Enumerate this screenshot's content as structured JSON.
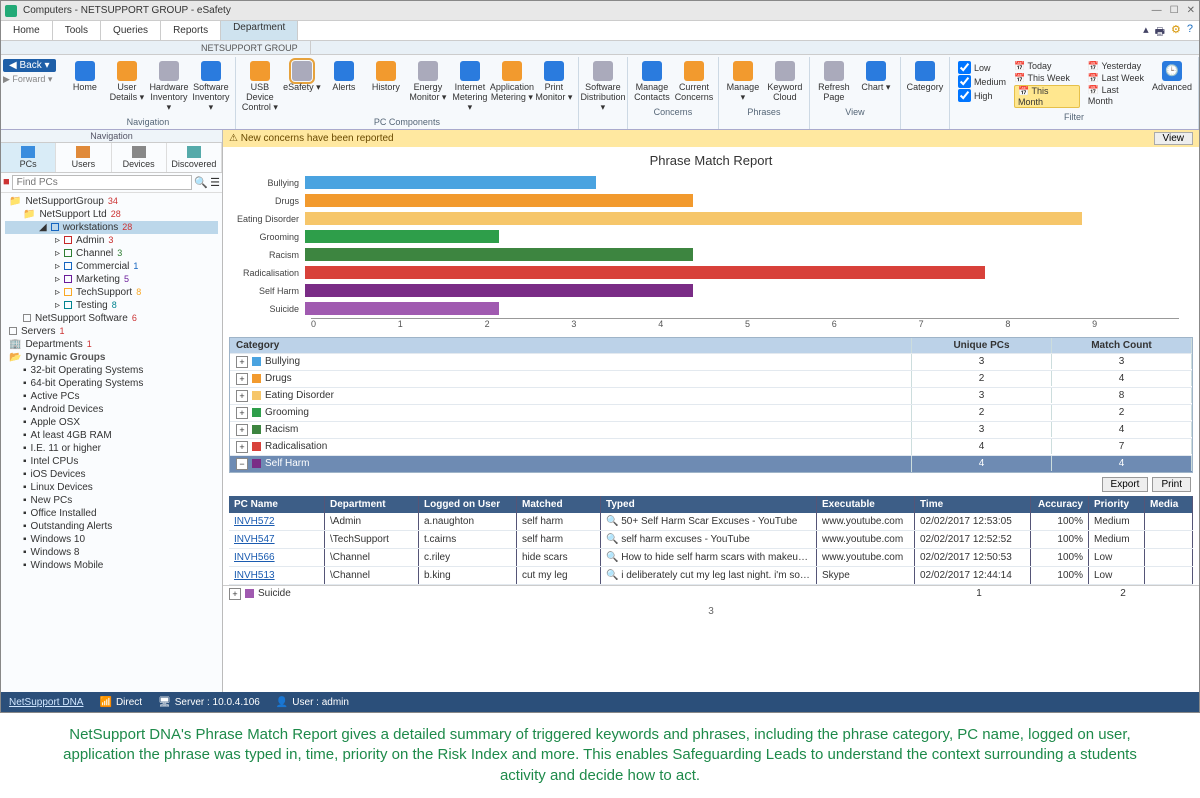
{
  "window": {
    "title": "Computers - NETSUPPORT GROUP - eSafety",
    "min": "—",
    "max": "☐",
    "close": "✕"
  },
  "tabs": {
    "main": "Department",
    "sub": "NETSUPPORT GROUP",
    "row_items": [
      "Home",
      "Tools",
      "Queries",
      "Reports"
    ]
  },
  "nav_back": "◀ Back ▾",
  "nav_fwd": "▶ Forward ▾",
  "ribbon": {
    "groups": [
      {
        "caption": "Navigation",
        "buttons": [
          "Home",
          "User Details ▾",
          "Hardware Inventory ▾",
          "Software Inventory ▾"
        ]
      },
      {
        "caption": "PC Components",
        "buttons": [
          "USB Device Control ▾",
          "eSafety ▾",
          "Alerts",
          "History",
          "Energy Monitor ▾",
          "Internet Metering ▾",
          "Application Metering ▾",
          "Print Monitor ▾"
        ]
      },
      {
        "caption": "",
        "buttons": [
          "Software Distribution ▾"
        ]
      },
      {
        "caption": "Concerns",
        "buttons": [
          "Manage Contacts",
          "Current Concerns"
        ]
      },
      {
        "caption": "Phrases",
        "buttons": [
          "Manage ▾",
          "Keyword Cloud"
        ]
      },
      {
        "caption": "View",
        "buttons": [
          "Refresh Page",
          "Chart ▾"
        ]
      },
      {
        "caption": "",
        "buttons": [
          "Category"
        ]
      }
    ],
    "filter": {
      "caption": "Filter",
      "severity": [
        "Low",
        "Medium",
        "High"
      ],
      "time_col1": [
        "Today",
        "This Week",
        "This Month"
      ],
      "time_col2": [
        "Yesterday",
        "Last Week",
        "Last Month"
      ],
      "advanced": "Advanced"
    }
  },
  "nav": {
    "caption": "Navigation",
    "tabs": [
      "PCs",
      "Users",
      "Devices",
      "Discovered"
    ],
    "search_placeholder": "Find PCs"
  },
  "tree": {
    "root": {
      "label": "NetSupportGroup",
      "count": "34"
    },
    "ltd": {
      "label": "NetSupport Ltd",
      "count": "28"
    },
    "ws": {
      "label": "workstations",
      "count": "28"
    },
    "ws_children": [
      {
        "label": "Admin",
        "count": "3",
        "color": "#c62828"
      },
      {
        "label": "Channel",
        "count": "3",
        "color": "#2e7d32"
      },
      {
        "label": "Commercial",
        "count": "1",
        "color": "#1565c0"
      },
      {
        "label": "Marketing",
        "count": "5",
        "color": "#6a1b9a"
      },
      {
        "label": "TechSupport",
        "count": "8",
        "color": "#f9a825"
      },
      {
        "label": "Testing",
        "count": "8",
        "color": "#00838f"
      }
    ],
    "nss": {
      "label": "NetSupport Software",
      "count": "6"
    },
    "servers": {
      "label": "Servers",
      "count": "1"
    },
    "depts": {
      "label": "Departments",
      "count": "1"
    },
    "dyn_header": "Dynamic Groups",
    "dynamic": [
      "32-bit Operating Systems",
      "64-bit Operating Systems",
      "Active PCs",
      "Android Devices",
      "Apple OSX",
      "At least 4GB RAM",
      "I.E. 11 or higher",
      "Intel CPUs",
      "iOS Devices",
      "Linux Devices",
      "New PCs",
      "Office Installed",
      "Outstanding Alerts",
      "Windows 10",
      "Windows 8",
      "Windows Mobile"
    ]
  },
  "alert": {
    "text": "New concerns have been reported",
    "view": "View"
  },
  "chart_data": {
    "type": "bar",
    "title": "Phrase Match Report",
    "categories": [
      "Bullying",
      "Drugs",
      "Eating Disorder",
      "Grooming",
      "Racism",
      "Radicalisation",
      "Self Harm",
      "Suicide"
    ],
    "values": [
      3,
      4,
      8,
      2,
      4,
      7,
      4,
      2
    ],
    "colors": [
      "#4aa3e0",
      "#f29a2e",
      "#f6c66a",
      "#2e9e4a",
      "#3d8540",
      "#d8413a",
      "#7a2c86",
      "#a05ab0"
    ],
    "xlabel": "",
    "ylabel": "",
    "xlim": [
      0,
      9
    ],
    "ticks": [
      "0",
      "1",
      "2",
      "3",
      "4",
      "5",
      "6",
      "7",
      "8",
      "9"
    ]
  },
  "cat_table": {
    "headers": [
      "Category",
      "Unique PCs",
      "Match Count"
    ],
    "rows": [
      {
        "name": "Bullying",
        "pcs": 3,
        "match": 3,
        "color": "#4aa3e0"
      },
      {
        "name": "Drugs",
        "pcs": 2,
        "match": 4,
        "color": "#f29a2e"
      },
      {
        "name": "Eating Disorder",
        "pcs": 3,
        "match": 8,
        "color": "#f6c66a"
      },
      {
        "name": "Grooming",
        "pcs": 2,
        "match": 2,
        "color": "#2e9e4a"
      },
      {
        "name": "Racism",
        "pcs": 3,
        "match": 4,
        "color": "#3d8540"
      },
      {
        "name": "Radicalisation",
        "pcs": 4,
        "match": 7,
        "color": "#d8413a"
      },
      {
        "name": "Self Harm",
        "pcs": 4,
        "match": 4,
        "color": "#7a2c86",
        "selected": true
      },
      {
        "name": "Suicide",
        "pcs": 1,
        "match": 2,
        "color": "#a05ab0",
        "footer": true
      }
    ]
  },
  "actions": {
    "export": "Export",
    "print": "Print"
  },
  "detail": {
    "headers": [
      "PC Name",
      "Department",
      "Logged on User",
      "Matched",
      "Typed",
      "Executable",
      "Time",
      "Accuracy",
      "Priority",
      "Media"
    ],
    "rows": [
      {
        "pc": "INVH572",
        "dept": "\\Admin",
        "user": "a.naughton",
        "matched": "self harm",
        "typed": "50+ Self Harm Scar Excuses - YouTube",
        "exe": "www.youtube.com",
        "time": "02/02/2017 12:53:05",
        "acc": "100%",
        "prio": "Medium"
      },
      {
        "pc": "INVH547",
        "dept": "\\TechSupport",
        "user": "t.cairns",
        "matched": "self harm",
        "typed": "self harm excuses - YouTube",
        "exe": "www.youtube.com",
        "time": "02/02/2017 12:52:52",
        "acc": "100%",
        "prio": "Medium"
      },
      {
        "pc": "INVH566",
        "dept": "\\Channel",
        "user": "c.riley",
        "matched": "hide scars",
        "typed": "How to hide self harm scars with makeup - YouTube",
        "exe": "www.youtube.com",
        "time": "02/02/2017 12:50:53",
        "acc": "100%",
        "prio": "Low"
      },
      {
        "pc": "INVH513",
        "dept": "\\Channel",
        "user": "b.king",
        "matched": "cut my leg",
        "typed": "i deliberately cut my leg last night. i'm so depressed",
        "exe": "Skype",
        "time": "02/02/2017 12:44:14",
        "acc": "100%",
        "prio": "Low"
      }
    ]
  },
  "pager": "3",
  "status": {
    "brand": "NetSupport DNA",
    "mode": "Direct",
    "server": "Server : 10.0.4.106",
    "user": "User : admin"
  },
  "caption": "NetSupport DNA's Phrase Match Report gives a detailed summary of triggered keywords and phrases, including the phrase category, PC name, logged on user, application the phrase was typed in, time, priority on the Risk Index and more. This enables Safeguarding Leads to understand the context surrounding a students activity and decide how to act."
}
